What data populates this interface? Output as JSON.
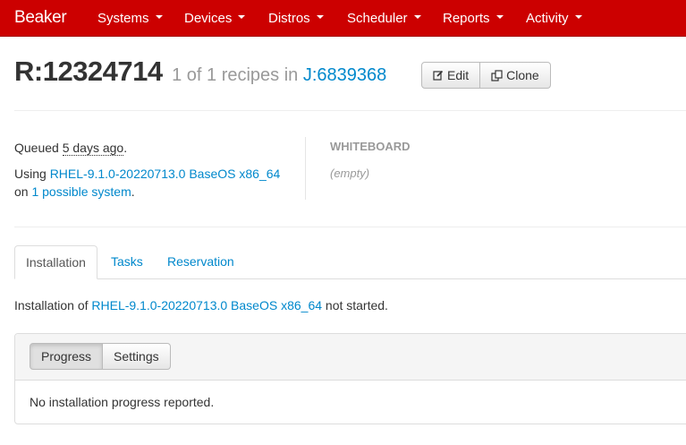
{
  "navbar": {
    "brand": "Beaker",
    "items": [
      {
        "label": "Systems"
      },
      {
        "label": "Devices"
      },
      {
        "label": "Distros"
      },
      {
        "label": "Scheduler"
      },
      {
        "label": "Reports"
      },
      {
        "label": "Activity"
      }
    ],
    "color": "#cc0000"
  },
  "header": {
    "recipe_id": "R:12324714",
    "subtitle_prefix": "1 of 1 recipes in",
    "job_link": "J:6839368",
    "edit_label": "Edit",
    "clone_label": "Clone",
    "edit_icon": "edit-icon",
    "clone_icon": "clone-icon"
  },
  "details": {
    "queued_prefix": "Queued",
    "queued_time": "5 days ago",
    "queued_suffix": ".",
    "using_prefix": "Using",
    "distro_link": "RHEL-9.1.0-20220713.0 BaseOS x86_64",
    "on_prefix": "on",
    "system_link": "1 possible system",
    "system_suffix": "."
  },
  "whiteboard": {
    "label": "WHITEBOARD",
    "value": "(empty)"
  },
  "tabs": [
    {
      "label": "Installation",
      "active": true
    },
    {
      "label": "Tasks",
      "active": false
    },
    {
      "label": "Reservation",
      "active": false
    }
  ],
  "installation": {
    "prefix": "Installation of",
    "distro_link": "RHEL-9.1.0-20220713.0 BaseOS x86_64",
    "suffix": "not started."
  },
  "panel": {
    "progress_label": "Progress",
    "settings_label": "Settings",
    "message": "No installation progress reported."
  },
  "colors": {
    "link": "#0088cc",
    "muted": "#999999"
  }
}
